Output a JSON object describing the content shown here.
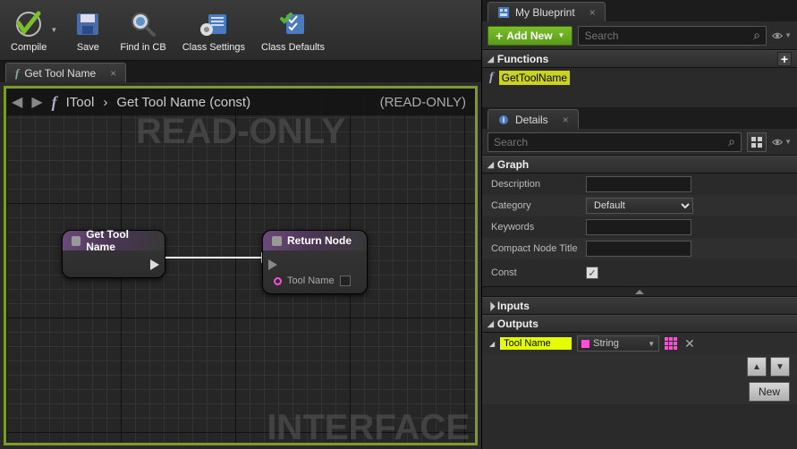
{
  "toolbar": {
    "compile": "Compile",
    "save": "Save",
    "find": "Find in CB",
    "settings": "Class Settings",
    "defaults": "Class Defaults"
  },
  "graphTab": {
    "title": "Get Tool Name"
  },
  "breadcrumb": {
    "root": "ITool",
    "leaf": "Get Tool Name (const)",
    "readonly": "(READ-ONLY)"
  },
  "watermark1": "READ-ONLY",
  "watermark2": "INTERFACE",
  "node_func": {
    "title": "Get Tool Name"
  },
  "node_return": {
    "title": "Return Node",
    "pin": "Tool Name"
  },
  "myBlueprint": {
    "tab": "My Blueprint",
    "addNew": "Add New",
    "searchPlaceholder": "Search",
    "sections": {
      "functions": "Functions"
    },
    "funcName": "GetToolName"
  },
  "details": {
    "tab": "Details",
    "searchPlaceholder": "Search",
    "sections": {
      "graph": "Graph",
      "inputs": "Inputs",
      "outputs": "Outputs"
    },
    "props": {
      "description": {
        "label": "Description",
        "value": ""
      },
      "category": {
        "label": "Category",
        "value": "Default"
      },
      "keywords": {
        "label": "Keywords",
        "value": ""
      },
      "compact": {
        "label": "Compact Node Title",
        "value": ""
      },
      "const": {
        "label": "Const",
        "checked": true
      }
    },
    "output": {
      "name": "Tool Name",
      "type": "String"
    },
    "newBtn": "New"
  }
}
